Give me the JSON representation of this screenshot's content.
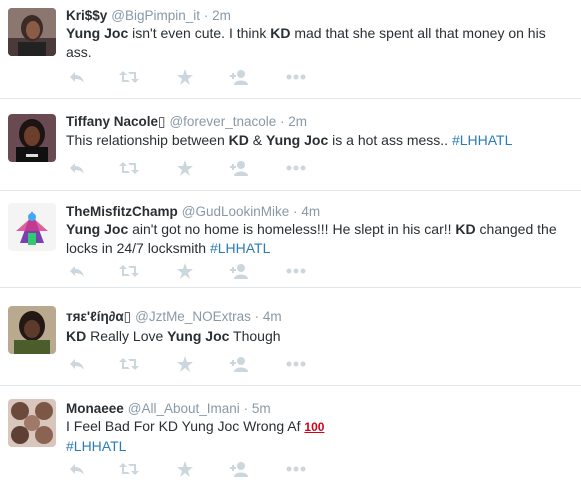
{
  "colors": {
    "text": "#292f33",
    "muted": "#8899a6",
    "link": "#2b7bb9",
    "icon": "#ccd6dd",
    "divider": "#e1e8ed"
  },
  "action_icons": [
    "reply-icon",
    "retweet-icon",
    "favorite-icon",
    "follow-icon",
    "more-icon"
  ],
  "tweets": [
    {
      "name": "Kri$$y",
      "handle": "@BigPimpin_it",
      "separator": "·",
      "time": "2m",
      "text": [
        {
          "t": "Yung Joc",
          "b": true
        },
        {
          "t": " isn't even cute. I think "
        },
        {
          "t": "KD",
          "b": true
        },
        {
          "t": " mad that she spent all that money on his ass."
        }
      ]
    },
    {
      "name": "Tiffany Nacole",
      "name_glyph": "▯",
      "handle": "@forever_tnacole",
      "separator": "·",
      "time": "2m",
      "text": [
        {
          "t": "This relationship between "
        },
        {
          "t": "KD",
          "b": true
        },
        {
          "t": " & "
        },
        {
          "t": "Yung Joc",
          "b": true
        },
        {
          "t": " is a hot ass mess.. "
        },
        {
          "t": "#LHHATL",
          "tag": true
        }
      ]
    },
    {
      "name": "TheMisfitzChamp",
      "handle": "@GudLookinMike",
      "separator": "·",
      "time": "4m",
      "text": [
        {
          "t": "Yung Joc",
          "b": true
        },
        {
          "t": " ain't got no home is homeless!!! He slept in his car!! "
        },
        {
          "t": "KD",
          "b": true
        },
        {
          "t": " changed the locks in 24/7 locksmith "
        },
        {
          "t": "#LHHATL",
          "tag": true
        }
      ]
    },
    {
      "name": "тяε'ℓíη∂α",
      "name_glyph": "▯",
      "handle": "@JztMe_NOExtras",
      "separator": "·",
      "time": "4m",
      "text": [
        {
          "t": "KD",
          "b": true
        },
        {
          "t": " Really Love "
        },
        {
          "t": "Yung Joc",
          "b": true
        },
        {
          "t": " Though"
        }
      ]
    },
    {
      "name": "Monaeee",
      "handle": "@All_About_Imani",
      "separator": "·",
      "time": "5m",
      "text": [
        {
          "t": "I Feel Bad For KD Yung Joc Wrong Af "
        },
        {
          "t": "100",
          "emoji": true
        },
        {
          "t": "\n"
        },
        {
          "t": "#LHHATL",
          "tag": true
        }
      ]
    }
  ]
}
